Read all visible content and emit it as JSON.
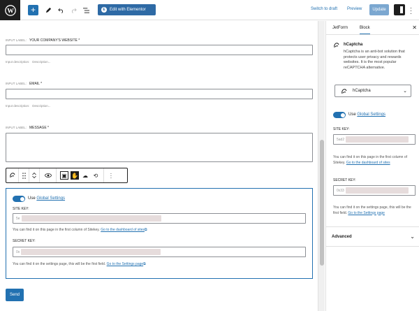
{
  "toolbar": {
    "elementor_label": "Edit with Elementor",
    "switch_to_draft": "Switch to draft",
    "preview": "Preview",
    "update": "Update",
    "add_symbol": "+"
  },
  "form": {
    "fields": [
      {
        "input_label_prefix": "INPUT LABEL:",
        "label": "YOUR COMPANY'S WEBSITE *",
        "desc_prefix": "Input description:",
        "desc": "Description..."
      },
      {
        "input_label_prefix": "INPUT LABEL:",
        "label": "EMAIL *",
        "desc_prefix": "Input description:",
        "desc": "Description..."
      },
      {
        "input_label_prefix": "INPUT LABEL:",
        "label": "MESSAGE *"
      }
    ],
    "send_label": "Send"
  },
  "captcha_block": {
    "use_label": "Use",
    "global_settings_link": "Global Settings",
    "site_key_label": "SITE KEY:",
    "site_key_value": "5e",
    "site_key_help": "You can find it on this page in the first column of Sitekey.",
    "site_key_help_link": "Go to the dashboard of sites",
    "secret_key_label": "SECRET KEY:",
    "secret_key_value": "0x",
    "secret_key_help": "You can find it on the settings page, this will be the first field.",
    "secret_key_help_link": "Go to the Settings page"
  },
  "sidebar": {
    "tabs": [
      "JetForm",
      "Block"
    ],
    "active_tab": "Block",
    "close_symbol": "✕",
    "block_title": "hCaptcha",
    "block_desc": "hCaptcha is an anti-bot solution that protects user privacy and rewards websites. It is the most popular reCAPTCHA alternative.",
    "select_value": "hCaptcha",
    "use_label": "Use",
    "global_settings_link": "Global Settings",
    "site_key_label": "SITE KEY:",
    "site_key_value": "5ad2",
    "site_key_help": "You can find it on this page in the first column of Sitekey.",
    "site_key_help_link": "Go to the dashboard of sites",
    "secret_key_label": "SECRET KEY:",
    "secret_key_value": "0x33",
    "secret_key_help": "You can find it on the settings page, this will be the first field.",
    "secret_key_help_link": "Go to the Settings page",
    "advanced_label": "Advanced"
  },
  "colors": {
    "accent": "#2271b1",
    "elementor": "#2e6aa5",
    "update_disabled": "#7ba7d0",
    "dark": "#1e1e1e"
  },
  "icons": [
    "wordpress-logo-icon",
    "pencil-icon",
    "undo-icon",
    "redo-icon",
    "list-view-icon",
    "elementor-icon",
    "settings-panel-icon",
    "kebab-icon",
    "hcaptcha-icon",
    "drag-icon",
    "move-up-icon",
    "move-down-icon",
    "eye-icon",
    "chevron-down-icon",
    "close-icon"
  ]
}
